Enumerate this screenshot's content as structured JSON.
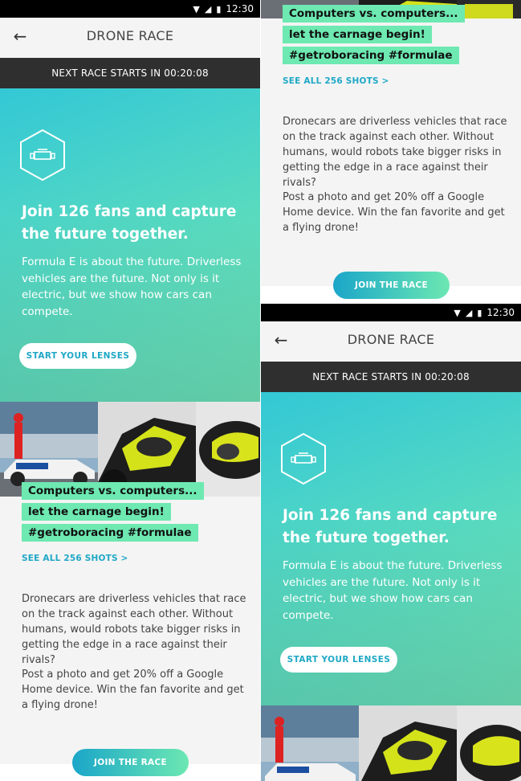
{
  "status": {
    "time": "12:30"
  },
  "appbar": {
    "title": "DRONE RACE",
    "back_icon": "arrow-left-icon"
  },
  "countdown": {
    "text": "NEXT RACE STARTS IN 00:20:08"
  },
  "hero": {
    "headline": "Join 126 fans and capture the future together.",
    "body": "Formula E is about the future. Driverless vehicles are the future. Not only is it electric, but we show how cars can compete.",
    "button_label": "START YOUR LENSES",
    "icon": "race-car-hexagon-icon"
  },
  "tags": {
    "line1": "Computers vs. computers...",
    "line2": "let the carnage begin!",
    "line3": "#getroboracing #formulae"
  },
  "see_all": "SEE ALL 256 SHOTS  >",
  "description": {
    "p1": "Dronecars are driverless vehicles that race on the track against each other. Without humans, would robots take bigger risks in getting the edge in a race against their rivals?",
    "p2": "Post a photo and get 20% off a Google Home device. Win the fan favorite and get a flying drone!"
  },
  "join_button": "JOIN THE RACE",
  "colors": {
    "accent": "#1fa8c6",
    "tag_bg": "#6de9b1",
    "countdown_bg": "#2f2f2f"
  }
}
